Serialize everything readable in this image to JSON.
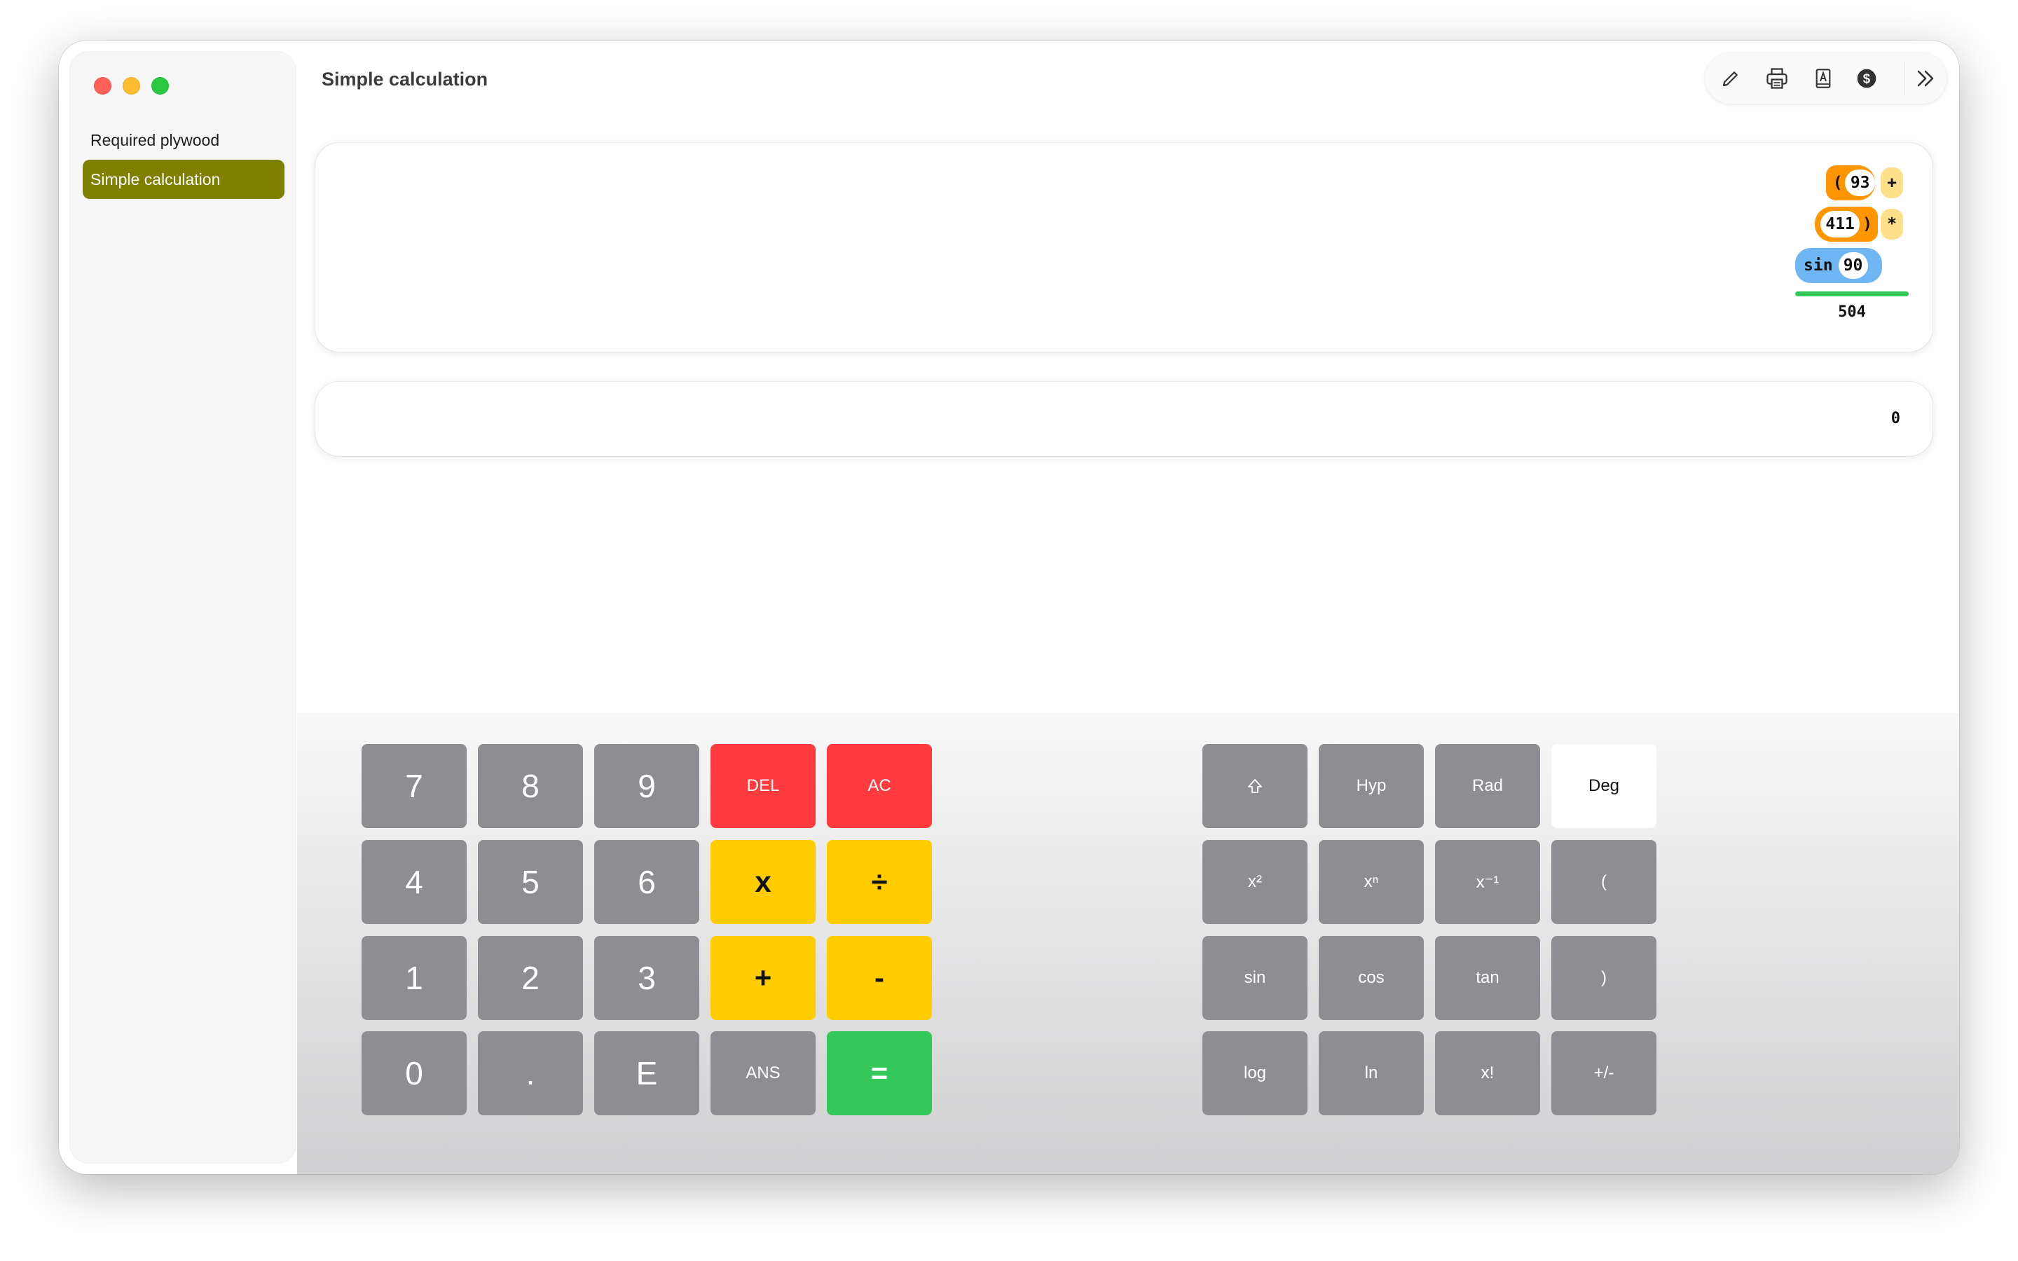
{
  "window": {
    "title": "Simple calculation"
  },
  "sidebar": {
    "items": [
      {
        "label": "Required plywood",
        "active": false
      },
      {
        "label": "Simple calculation",
        "active": true
      }
    ]
  },
  "toolbar": {
    "icons": [
      "pencil-icon",
      "printer-icon",
      "book-icon",
      "dollar-coin-icon",
      "chevron-double-right-icon"
    ]
  },
  "history": {
    "line1": {
      "open_paren": "(",
      "number": "93",
      "operator": "+"
    },
    "line2": {
      "number": "411",
      "close_paren": ")",
      "operator": "*"
    },
    "line3": {
      "function": "sin",
      "argument": "90"
    },
    "result": "504"
  },
  "display": {
    "value": "0"
  },
  "keypad": {
    "basic": [
      [
        "7",
        "8",
        "9",
        "DEL",
        "AC"
      ],
      [
        "4",
        "5",
        "6",
        "x",
        "÷"
      ],
      [
        "1",
        "2",
        "3",
        "+",
        "-"
      ],
      [
        "0",
        ".",
        "E",
        "ANS",
        "="
      ]
    ],
    "scientific": [
      [
        "⇧",
        "Hyp",
        "Rad",
        "Deg"
      ],
      [
        "x²",
        "xⁿ",
        "x⁻¹",
        "("
      ],
      [
        "sin",
        "cos",
        "tan",
        ")"
      ],
      [
        "log",
        "ln",
        "x!",
        "+/-"
      ]
    ],
    "angle_mode_selected": "Deg"
  },
  "colors": {
    "sidebar_active": "#808000",
    "key_gray": "#8e8e92",
    "key_red": "#ff3b3f",
    "key_yellow": "#ffcc00",
    "key_green": "#34c759",
    "paren_orange": "#ff9500",
    "operator_yellow": "#fee08a",
    "function_blue": "#6fb6f5"
  }
}
